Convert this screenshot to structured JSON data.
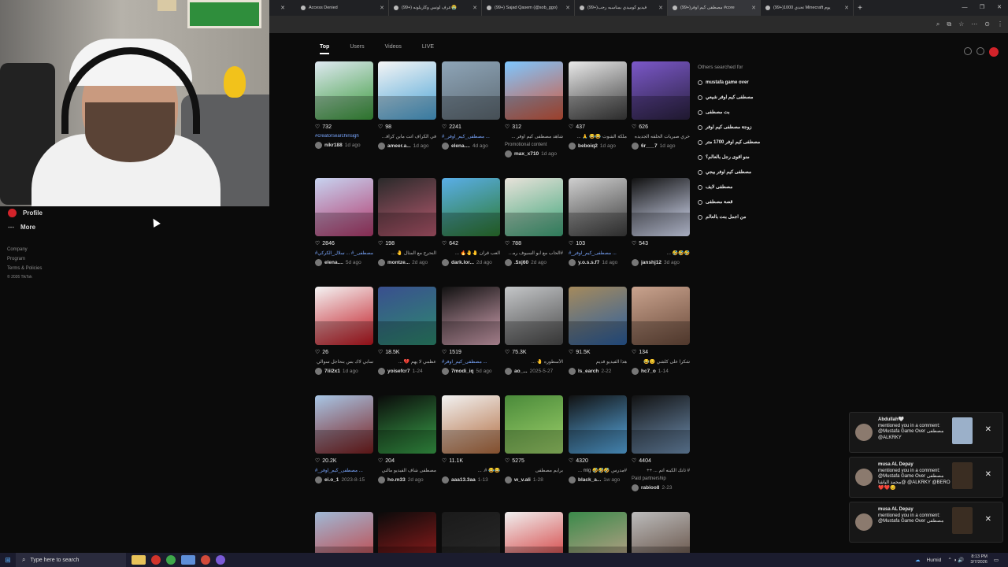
{
  "browser": {
    "tabs": [
      {
        "title": "Access Denied",
        "active": false
      },
      {
        "title": "(99+) عرف لونس وكاريلونه😭",
        "active": false
      },
      {
        "title": "(99+) Sajad Qasem (@sob_ggo)",
        "active": false
      },
      {
        "title": "(99+)فيديو كوميدي بمناسبه رجب",
        "active": false
      },
      {
        "title": "(99+)مصطفى كيم اوفر #core",
        "active": true
      },
      {
        "title": "(99+)تحدي 1000 Minecraft يوم",
        "active": false
      }
    ],
    "new_tab": "+",
    "window_controls": [
      "—",
      "❐",
      "✕"
    ],
    "toolbar_icons": [
      "⌕",
      "⧉",
      "☆",
      "⋯",
      "⊙",
      "⋮"
    ]
  },
  "sidebar": {
    "profile_label": "Profile",
    "more_label": "More",
    "footer": [
      "Company",
      "Program",
      "Terms & Policies",
      "© 2026 TikTok"
    ]
  },
  "search_tabs": [
    "Top",
    "Users",
    "Videos",
    "LIVE"
  ],
  "others": {
    "title": "Others searched for",
    "items": [
      "mustafa game over",
      "مصطفى كيم اوفر شيعي",
      "بت مصطفى",
      "زوجة مصطفى كيم اوفر",
      "مصطفى كيم اوفر 1700 متر",
      "منو اقوى رجل بالعالم؟",
      "مصطفى كيم اوفر بيجي",
      "مصطفى لايف",
      "قصة مصطفى",
      "من اجمل بنت بالعالم"
    ]
  },
  "videos": [
    {
      "likes": "732",
      "caption": "#creatorsearchinsigh",
      "tag": true,
      "user": "nikr188",
      "date": "1d ago",
      "colors": [
        "#dfe9f2",
        "#3b9a3b"
      ]
    },
    {
      "likes": "98",
      "caption": "في الكراف اتت مابن كرافت ...",
      "tag": false,
      "user": "ameer.a...",
      "date": "1d ago",
      "colors": [
        "#f5f5f5",
        "#4aa3d6"
      ]
    },
    {
      "likes": "2241",
      "caption": "#_مصطفى_كيم_اوفر ...",
      "tag": true,
      "user": "elena....",
      "date": "4d ago",
      "colors": [
        "#8ea5b8",
        "#5e6a73"
      ]
    },
    {
      "likes": "312",
      "caption": "شاهد مصطفى كيم اوفر ...",
      "tag": false,
      "promo": "Promotional content",
      "user": "max_x710",
      "date": "1d ago",
      "colors": [
        "#7ec7ff",
        "#d2563a"
      ]
    },
    {
      "likes": "437",
      "caption": "ملكة الشوت 😂😂 🙏 ...",
      "tag": false,
      "user": "beboiq2",
      "date": "1d ago",
      "colors": [
        "#e9e9e9",
        "#3b3b3b"
      ]
    },
    {
      "likes": "626",
      "caption": "خري صبريات الحلقه الجديده",
      "tag": false,
      "user": "6r___7",
      "date": "1d ago",
      "colors": [
        "#7b58c9",
        "#2a2140"
      ]
    },
    {
      "likes": "2846",
      "caption": "#مصطفى_# ... سلال_الكركي",
      "tag": true,
      "user": "elena....",
      "date": "5d ago",
      "colors": [
        "#c7d3f0",
        "#b23a6d"
      ]
    },
    {
      "likes": "198",
      "caption": "النحرج مع المثال 🤚 ...",
      "tag": false,
      "user": "montze...",
      "date": "2d ago",
      "colors": [
        "#2a2a2a",
        "#b85a70"
      ]
    },
    {
      "likes": "642",
      "caption": "العب قرآن 🤚🤚🔥 ...",
      "tag": false,
      "user": "dark.lor...",
      "date": "2d ago",
      "colors": [
        "#5aaee8",
        "#2d7a2f"
      ]
    },
    {
      "likes": "788",
      "caption": "#الحاب مع ابو السيوف رمضان",
      "tag": false,
      "user": ".5xj60",
      "date": "2d ago",
      "colors": [
        "#e8e2da",
        "#3fa67a"
      ]
    },
    {
      "likes": "103",
      "caption": "#_مصطفى_كيم_اوفر ...",
      "tag": true,
      "user": "y.o.s.s.f7",
      "date": "1d ago",
      "colors": [
        "#cfcfcf",
        "#3c3c3c"
      ]
    },
    {
      "likes": "543",
      "caption": "🤣🤣🤣 ...",
      "tag": false,
      "user": "janshj12",
      "date": "3d ago",
      "colors": [
        "#111111",
        "#dfe6ff"
      ]
    },
    {
      "likes": "26",
      "caption": "سابي لاك بس بنحاجل سوالي",
      "tag": false,
      "user": "7iii2x1",
      "date": "1d ago",
      "colors": [
        "#f4f4f4",
        "#c0141e"
      ]
    },
    {
      "likes": "18.5K",
      "caption": "عظمي لا يهم 💔 ...",
      "tag": false,
      "user": "yoisefcr7",
      "date": "1-24",
      "colors": [
        "#3a4f8f",
        "#2d8a6e"
      ]
    },
    {
      "likes": "1519",
      "caption": "#مصطفى_كيم_اوفر ...",
      "tag": true,
      "user": "7modi_iq",
      "date": "5d ago",
      "colors": [
        "#111111",
        "#d7a6b6"
      ]
    },
    {
      "likes": "75.3K",
      "caption": "الأسطوره 🤚 ...",
      "tag": false,
      "user": "ao_...",
      "date": "2025-5-27",
      "colors": [
        "#c4c6c8",
        "#4a4a4a"
      ]
    },
    {
      "likes": "91.5K",
      "caption": "هذا الفيديو قديم",
      "tag": false,
      "user": "ls_earch",
      "date": "2-22",
      "colors": [
        "#a58a5c",
        "#2b5fa0"
      ]
    },
    {
      "likes": "134",
      "caption": "شكراً على كلشي 😊😂",
      "tag": false,
      "user": "hc7_o",
      "date": "1-14",
      "colors": [
        "#c9a38e",
        "#6b4b3b"
      ]
    },
    {
      "likes": "20.2K",
      "caption": "#_مصطفى_كيم_اوفر ...",
      "tag": true,
      "user": "ei.o_1",
      "date": "2023-8-15",
      "colors": [
        "#a8c7e6",
        "#7a1d1d"
      ]
    },
    {
      "likes": "204",
      "caption": "مصطفى شاف الفيديو مالتي",
      "tag": false,
      "user": "ho.m33",
      "date": "2d ago",
      "colors": [
        "#0a0a0a",
        "#3aa34a"
      ]
    },
    {
      "likes": "11.1K",
      "caption": "😂😂 #. ...",
      "tag": false,
      "user": "aaa13.3aa",
      "date": "1-13",
      "colors": [
        "#f2f2f2",
        "#b06a3d"
      ]
    },
    {
      "likes": "5275",
      "caption": "برايم مصطفى",
      "tag": false,
      "user": "w_v.ali",
      "date": "1-28",
      "colors": [
        "#4a8a3a",
        "#9dd06a"
      ]
    },
    {
      "likes": "4320",
      "caption": "#مدرس 🤣🤣🤣 mlg ...",
      "tag": false,
      "user": "black_a...",
      "date": "1w ago",
      "colors": [
        "#111111",
        "#5aaee8"
      ]
    },
    {
      "likes": "4404",
      "caption": "# ثانك الكبنه اتم ... ++",
      "tag": false,
      "promo": "Paid partnership",
      "user": "rabioo8",
      "date": "2-23",
      "colors": [
        "#111111",
        "#6f8fb1"
      ]
    },
    {
      "likes": "",
      "caption": "",
      "tag": false,
      "user": "",
      "date": "",
      "colors": [
        "#9fb9d6",
        "#c43a3a"
      ]
    },
    {
      "likes": "",
      "caption": "",
      "tag": false,
      "user": "",
      "date": "",
      "colors": [
        "#0a0a0a",
        "#a01e1e"
      ]
    },
    {
      "likes": "",
      "caption": "",
      "tag": false,
      "user": "",
      "date": "",
      "colors": [
        "#1a1a1a",
        "#2a2a2a"
      ]
    },
    {
      "likes": "",
      "caption": "",
      "tag": false,
      "user": "",
      "date": "",
      "colors": [
        "#f0f0f0",
        "#d12a2a"
      ]
    },
    {
      "likes": "",
      "caption": "",
      "tag": false,
      "user": "",
      "date": "",
      "colors": [
        "#3a8a4a",
        "#c9a38e"
      ]
    },
    {
      "likes": "",
      "caption": "",
      "tag": false,
      "user": "",
      "date": "",
      "colors": [
        "#bcbcbc",
        "#5a4336"
      ]
    }
  ],
  "notifications": [
    {
      "name": "Abdullah🤍",
      "text": "mentioned you in a comment: @Mustafa Game Over مصطفى @ALKRKY",
      "pic": "#9bb0c9"
    },
    {
      "name": "musa AL Depay",
      "text": "mentioned you in a comment: @Mustafa Game Over مصطفى @محمد الياشا @ALKRKY @BERO ❤️❤️😊",
      "pic": "#3a2d22"
    },
    {
      "name": "musa AL Depay",
      "text": "mentioned you in a comment: @Mustafa Game Over مصطفى",
      "pic": "#3a2d22"
    }
  ],
  "taskbar": {
    "search_placeholder": "Type here to search",
    "weather": "Humid",
    "time": "8:13 PM",
    "date": "3/7/2026"
  }
}
